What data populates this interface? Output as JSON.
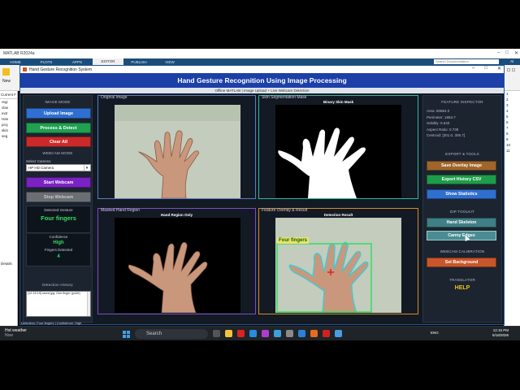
{
  "matlab": {
    "window_title": "MATLAB R2024a",
    "tabs": [
      "HOME",
      "PLOTS",
      "APPS",
      "EDITOR",
      "PUBLISH",
      "VIEW"
    ],
    "active_tab": "EDITOR",
    "search_placeholder": "Search Documentation",
    "user": "Al",
    "new_label": "New",
    "current_folder": "Current F",
    "files": [
      "regi",
      "clas",
      "extr",
      "Han",
      "proj",
      "skin",
      "seg"
    ],
    "details_label": "Details",
    "right_items": [
      "1",
      "2",
      "3",
      "4",
      "5",
      "6",
      "7",
      "8",
      "9",
      "10",
      "11"
    ]
  },
  "app": {
    "window_title": "Hand Gesture Recognition System",
    "header": "Hand Gesture Recognition Using Image Processing",
    "subtitle": "Offline MATLAB  |  Image Upload  +  Live Webcam Detection",
    "left": {
      "image_mode": "IMAGE MODE",
      "upload": "Upload Image",
      "process": "Process & Detect",
      "clear": "Clear All",
      "webcam_mode": "WEBCAM MODE",
      "select_camera_label": "Select Camera:",
      "camera_value": "HP HD Camera",
      "start_webcam": "Start Webcam",
      "stop_webcam": "Stop Webcam",
      "detected_label": "Detected Gesture",
      "detected_value": "Four fingers",
      "confidence_label": "Confidence",
      "confidence_value": "High",
      "fingers_label": "Fingers Detected",
      "fingers_value": "4",
      "history_label": "Detection History",
      "history": [
        "[12:15:19] sixed.jpg: One finger (point)",
        "[12:15:23] four1.jpeg: Four fingers"
      ],
      "status_line": "Detection: Four fingers  |  Confidence: High"
    },
    "panels": {
      "original": "Original Image",
      "skin": "Skin Segmentation Mask",
      "skin_inner": "Binary Skin Mask",
      "masked": "Masked Hand Region",
      "masked_inner": "Hand Region Only",
      "overlay": "Feature Overlay & Result",
      "overlay_inner": "Detection Result",
      "overlay_tag": "Four fingers"
    },
    "right": {
      "inspector": "FEATURE INSPECTOR",
      "stats": [
        "Area: 80884.0",
        "Perimeter: 1863.7",
        "Solidity: 0.640",
        "Aspect Ratio: 0.739",
        "Centroid: [301.0, 305.7]"
      ],
      "export": "EXPORT & TOOLS",
      "save_overlay": "Save Overlay Image",
      "export_csv": "Export History CSV",
      "show_stats": "Show Statistics",
      "dip": "DIP TOOLKIT",
      "hand_skeleton": "Hand Skeleton",
      "canny": "Canny Edges",
      "webcam_cal": "WEBCAM CALIBRATION",
      "set_bg": "Set Background",
      "translator": "TRANSLATOR",
      "translator_value": "HELP"
    }
  },
  "taskbar": {
    "weather_title": "Hot weather",
    "weather_sub": "Now",
    "search": "Search",
    "lang": "ENG",
    "time": "12:15 PM",
    "date": "5/18/2026"
  },
  "colors": {
    "header": "#1c3fa8",
    "accent_green": "#2ee060",
    "translator": "#f0c020"
  }
}
